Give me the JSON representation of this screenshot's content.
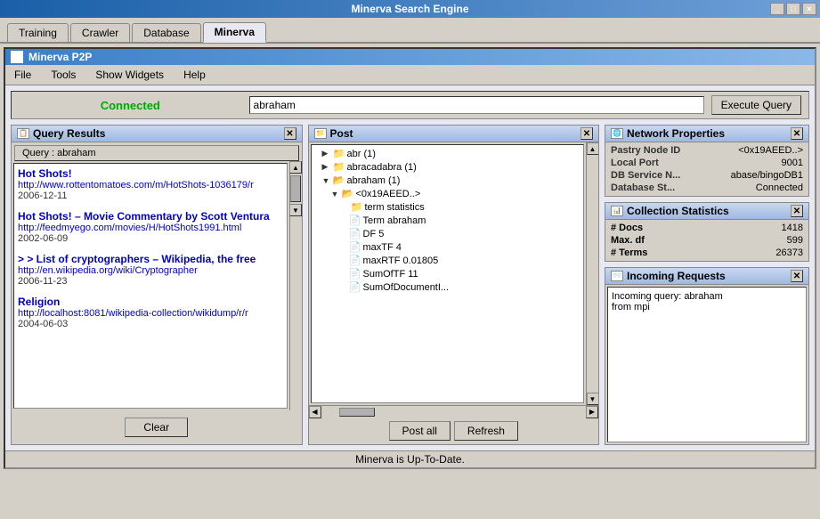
{
  "window": {
    "title": "Minerva Search Engine",
    "title_buttons": [
      "_",
      "□",
      "×"
    ]
  },
  "tabs": [
    {
      "label": "Training",
      "active": false
    },
    {
      "label": "Crawler",
      "active": false
    },
    {
      "label": "Database",
      "active": false
    },
    {
      "label": "Minerva",
      "active": true
    }
  ],
  "inner_window": {
    "title": "Minerva P2P",
    "menus": [
      "File",
      "Tools",
      "Show Widgets",
      "Help"
    ]
  },
  "connection": {
    "status": "Connected",
    "search_value": "abraham",
    "execute_btn": "Execute Query"
  },
  "query_results": {
    "panel_title": "Query Results",
    "query_tab": "Query : abraham",
    "results": [
      {
        "title": "Hot Shots!",
        "url": "http://www.rottentomatoes.com/m/HotShots-1036179/r",
        "date": "2006-12-11"
      },
      {
        "title": "Hot Shots! – Movie Commentary by Scott Ventura",
        "url": "http://feedmyego.com/movies/H/HotShots1991.html",
        "date": "2002-06-09"
      },
      {
        "title": "> > List of cryptographers – Wikipedia, the free",
        "url": "http://en.wikipedia.org/wiki/Cryptographer",
        "date": "2006-11-23"
      },
      {
        "title": "Religion",
        "url": "http://localhost:8081/wikipedia-collection/wikidump/r/r",
        "date": "2004-06-03"
      }
    ],
    "clear_btn": "Clear"
  },
  "post_panel": {
    "panel_title": "Post",
    "tree_nodes": [
      {
        "indent": 1,
        "type": "folder",
        "label": "abr (1)",
        "arrow": "▶"
      },
      {
        "indent": 1,
        "type": "folder",
        "label": "abracadabra (1)",
        "arrow": "▶"
      },
      {
        "indent": 1,
        "type": "folder",
        "label": "abraham (1)",
        "arrow": "▼",
        "expanded": true
      },
      {
        "indent": 2,
        "type": "folder",
        "label": "<0x19AEED..>",
        "arrow": "▼",
        "expanded": true
      },
      {
        "indent": 3,
        "type": "folder",
        "label": "term statistics",
        "arrow": ""
      },
      {
        "indent": 4,
        "type": "file",
        "label": "Term abraham"
      },
      {
        "indent": 4,
        "type": "file",
        "label": "DF 5"
      },
      {
        "indent": 4,
        "type": "file",
        "label": "maxTF 4"
      },
      {
        "indent": 4,
        "type": "file",
        "label": "maxRTF 0.01805"
      },
      {
        "indent": 4,
        "type": "file",
        "label": "SumOfTF 11"
      },
      {
        "indent": 4,
        "type": "file",
        "label": "SumOfDocumentI..."
      }
    ],
    "post_btn": "Post all",
    "refresh_btn": "Refresh"
  },
  "network_properties": {
    "panel_title": "Network Properties",
    "rows": [
      {
        "label": "Pastry Node ID",
        "value": "<0x19AEED..>"
      },
      {
        "label": "Local Port",
        "value": "9001"
      },
      {
        "label": "DB Service N...",
        "value": "abase/bingoDB1"
      },
      {
        "label": "Database St...",
        "value": "Connected"
      }
    ]
  },
  "collection_statistics": {
    "panel_title": "Collection Statistics",
    "rows": [
      {
        "label": "# Docs",
        "value": "1418"
      },
      {
        "label": "Max. df",
        "value": "599"
      },
      {
        "label": "# Terms",
        "value": "26373"
      }
    ]
  },
  "incoming_requests": {
    "panel_title": "Incoming Requests",
    "text": "Incoming query: abraham\nfrom mpi"
  },
  "status_bar": {
    "text": "Minerva is Up-To-Date."
  }
}
